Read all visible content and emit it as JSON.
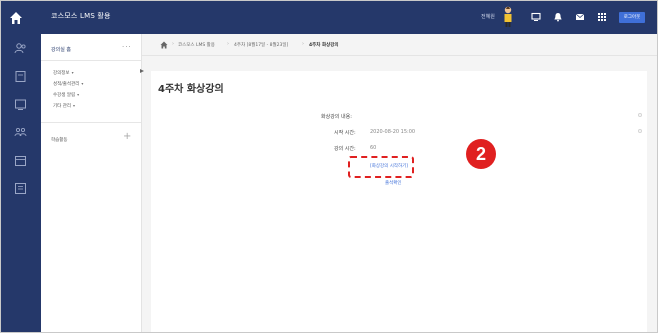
{
  "topbar": {
    "title": "코스모스 LMS 활용",
    "user_name": "전혜원",
    "logout_label": "로그아웃"
  },
  "sidebar": {
    "header": "강의실 홈",
    "menu_dots": "···",
    "items": [
      {
        "label": "강의정보",
        "has_dropdown": true
      },
      {
        "label": "성적/출석관리",
        "has_dropdown": true
      },
      {
        "label": "수강생 알림",
        "has_dropdown": true
      },
      {
        "label": "기타 관리",
        "has_dropdown": true
      }
    ],
    "dropdown_mark": "▾",
    "activities_label": "학습활동",
    "plus_label": "+"
  },
  "breadcrumb": {
    "items": [
      "코스모스 LMS 활용",
      "4주차 [8월17일 - 8월23일]",
      "4주차 화상강의"
    ],
    "separator": "›"
  },
  "page": {
    "title": "4주차 화상강의",
    "content_label": "화상강의 내용:",
    "start_label": "시작 시간:",
    "start_value": "2020-08-20 15:00",
    "duration_label": "강의 시간:",
    "duration_value": "60",
    "launch_link": "[화상강의 시작하기]",
    "attendance_link": "출석확인"
  },
  "annotation": {
    "step_number": "2",
    "color": "#e02020"
  },
  "colors": {
    "navbar": "#25386a",
    "accent": "#3f6fd8"
  }
}
